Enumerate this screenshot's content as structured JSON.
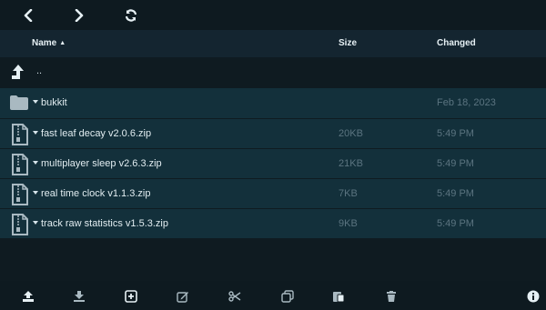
{
  "toolbar": {
    "back_icon": "chevron-left-icon",
    "forward_icon": "chevron-right-icon",
    "refresh_icon": "refresh-icon"
  },
  "table": {
    "columns": [
      "Name",
      "Size",
      "Changed"
    ],
    "sort_indicator": "▲",
    "parent_label": "..",
    "rows": [
      {
        "name": "bukkit",
        "size": "",
        "changed": "Feb 18, 2023",
        "type": "folder"
      },
      {
        "name": "fast leaf decay v2.0.6.zip",
        "size": "20KB",
        "changed": "5:49 PM",
        "type": "zip"
      },
      {
        "name": "multiplayer sleep v2.6.3.zip",
        "size": "21KB",
        "changed": "5:49 PM",
        "type": "zip"
      },
      {
        "name": "real time clock v1.1.3.zip",
        "size": "7KB",
        "changed": "5:49 PM",
        "type": "zip"
      },
      {
        "name": "track raw statistics v1.5.3.zip",
        "size": "9KB",
        "changed": "5:49 PM",
        "type": "zip"
      }
    ]
  },
  "footer": {
    "icons": [
      "upload-icon",
      "download-icon",
      "new-icon",
      "rename-icon",
      "cut-icon",
      "copy-icon",
      "paste-icon",
      "delete-icon",
      "info-icon"
    ]
  },
  "colors": {
    "background": "#0f1b21",
    "header": "#142530",
    "row": "#13303b",
    "muted_text": "#5b7480"
  }
}
